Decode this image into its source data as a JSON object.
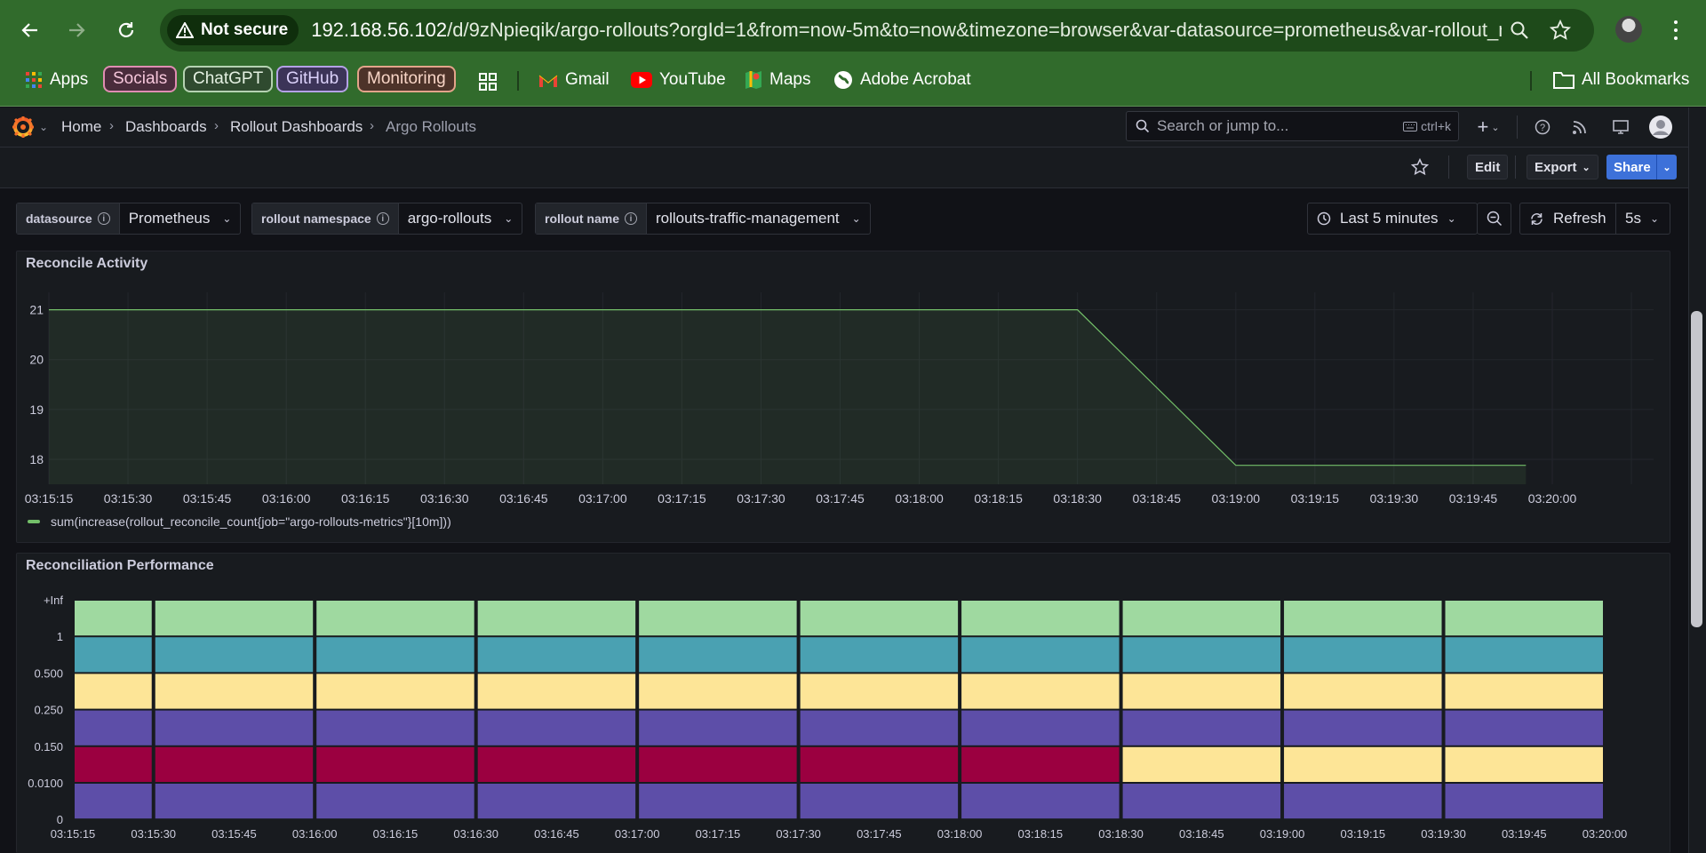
{
  "browser": {
    "security_label": "Not secure",
    "url_host": "192.168.56.102",
    "url_path": "/d/9zNpieqik/argo-rollouts?orgId=1&from=now-5m&to=now&timezone=browser&var-datasource=prometheus&var-rollout_n...",
    "bookmarks": {
      "apps": "Apps",
      "socials": "Socials",
      "chatgpt": "ChatGPT",
      "github": "GitHub",
      "monitoring": "Monitoring",
      "gmail": "Gmail",
      "youtube": "YouTube",
      "maps": "Maps",
      "acrobat": "Adobe Acrobat",
      "all": "All Bookmarks"
    },
    "colors": {
      "chrome": "#316b2c",
      "omnibox": "#1e4a1a"
    }
  },
  "breadcrumb": {
    "home": "Home",
    "dashboards": "Dashboards",
    "folder": "Rollout Dashboards",
    "current": "Argo Rollouts"
  },
  "search": {
    "placeholder": "Search or jump to...",
    "shortcut": "ctrl+k"
  },
  "actions": {
    "edit": "Edit",
    "export": "Export",
    "share": "Share"
  },
  "variables": [
    {
      "label": "datasource",
      "value": "Prometheus"
    },
    {
      "label": "rollout namespace",
      "value": "argo-rollouts"
    },
    {
      "label": "rollout name",
      "value": "rollouts-traffic-management"
    }
  ],
  "time": {
    "range": "Last 5 minutes",
    "refresh": "Refresh",
    "interval": "5s"
  },
  "panels": {
    "reconcile": {
      "title": "Reconcile Activity"
    },
    "performance": {
      "title": "Reconciliation Performance"
    }
  },
  "chart_data": [
    {
      "type": "line",
      "title": "Reconcile Activity",
      "x_ticks": [
        "03:15:15",
        "03:15:30",
        "03:15:45",
        "03:16:00",
        "03:16:15",
        "03:16:30",
        "03:16:45",
        "03:17:00",
        "03:17:15",
        "03:17:30",
        "03:17:45",
        "03:18:00",
        "03:18:15",
        "03:18:30",
        "03:18:45",
        "03:19:00",
        "03:19:15",
        "03:19:30",
        "03:19:45",
        "03:20:00"
      ],
      "y_ticks": [
        18,
        19,
        20,
        21
      ],
      "ylim": [
        17.5,
        21.35
      ],
      "xlim": [
        "03:15:15",
        "03:20:00"
      ],
      "series": [
        {
          "name": "sum(increase(rollout_reconcile_count{job=\"argo-rollouts-metrics\"}[10m]))",
          "color": "#73bf69",
          "points": [
            [
              "03:15:15",
              21
            ],
            [
              "03:18:30",
              21
            ],
            [
              "03:19:00",
              17.88
            ],
            [
              "03:19:55",
              17.88
            ]
          ]
        }
      ],
      "grid": true,
      "legend": "bottom-left"
    },
    {
      "type": "heatmap",
      "title": "Reconciliation Performance",
      "y_buckets": [
        "0",
        "0.0100",
        "0.150",
        "0.250",
        "0.500",
        "1",
        "+Inf"
      ],
      "x_ticks": [
        "03:15:15",
        "03:15:30",
        "03:15:45",
        "03:16:00",
        "03:16:15",
        "03:16:30",
        "03:16:45",
        "03:17:00",
        "03:17:15",
        "03:17:30",
        "03:17:45",
        "03:18:00",
        "03:18:15",
        "03:18:30",
        "03:18:45",
        "03:19:00",
        "03:19:15",
        "03:19:30",
        "03:19:45",
        "03:20:00"
      ],
      "columns": [
        "03:15:15",
        "03:15:30",
        "03:16:00",
        "03:16:30",
        "03:17:00",
        "03:17:30",
        "03:18:00",
        "03:18:30",
        "03:19:00",
        "03:19:30"
      ],
      "column_end": "03:20:00",
      "palette": {
        "green": "#9fd9a0",
        "teal": "#4aa1b2",
        "yellow": "#fde597",
        "purple": "#5d4ea8",
        "crimson": "#9b0040"
      },
      "cells": [
        [
          "purple",
          "purple",
          "purple",
          "purple",
          "purple",
          "purple",
          "purple",
          "purple",
          "purple",
          "purple"
        ],
        [
          "crimson",
          "crimson",
          "crimson",
          "crimson",
          "crimson",
          "crimson",
          "crimson",
          "yellow",
          "yellow",
          "yellow"
        ],
        [
          "purple",
          "purple",
          "purple",
          "purple",
          "purple",
          "purple",
          "purple",
          "purple",
          "purple",
          "purple"
        ],
        [
          "yellow",
          "yellow",
          "yellow",
          "yellow",
          "yellow",
          "yellow",
          "yellow",
          "yellow",
          "yellow",
          "yellow"
        ],
        [
          "teal",
          "teal",
          "teal",
          "teal",
          "teal",
          "teal",
          "teal",
          "teal",
          "teal",
          "teal"
        ],
        [
          "green",
          "green",
          "green",
          "green",
          "green",
          "green",
          "green",
          "green",
          "green",
          "green"
        ]
      ]
    }
  ]
}
